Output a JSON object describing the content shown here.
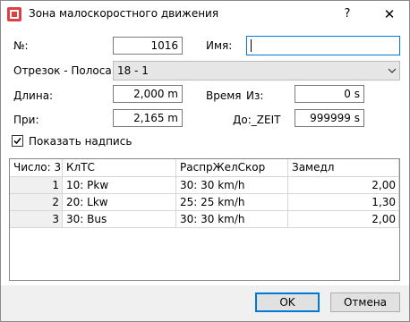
{
  "window": {
    "title": "Зона малоскоростного движения",
    "help_label": "?",
    "close_label": "✕"
  },
  "form": {
    "number_label": "№:",
    "number_value": "1016",
    "name_label": "Имя:",
    "name_value": "",
    "segment_label": "Отрезок - Полоса:",
    "segment_value": "18 - 1",
    "length_label": "Длина:",
    "length_value": "2,000 m",
    "at_label": "При:",
    "at_value": "2,165 m",
    "time_label": "Время",
    "from_label": "Из:",
    "from_value": "0 s",
    "to_label": "До:_ZEIT",
    "to_value": "999999 s",
    "show_label_text": "Показать надпись",
    "show_label_checked": true
  },
  "table": {
    "headers": [
      "Число: 3",
      "КлТС",
      "РаспрЖелСкор",
      "Замедл"
    ],
    "rows": [
      {
        "num": "1",
        "vehicle_class": "10: Pkw",
        "speed_distribution": "30: 30 km/h",
        "decel": "2,00"
      },
      {
        "num": "2",
        "vehicle_class": "20: Lkw",
        "speed_distribution": "25: 25 km/h",
        "decel": "1,30"
      },
      {
        "num": "3",
        "vehicle_class": "30: Bus",
        "speed_distribution": "30: 30 km/h",
        "decel": "2,00"
      }
    ]
  },
  "buttons": {
    "ok": "OK",
    "cancel": "Отмена"
  }
}
